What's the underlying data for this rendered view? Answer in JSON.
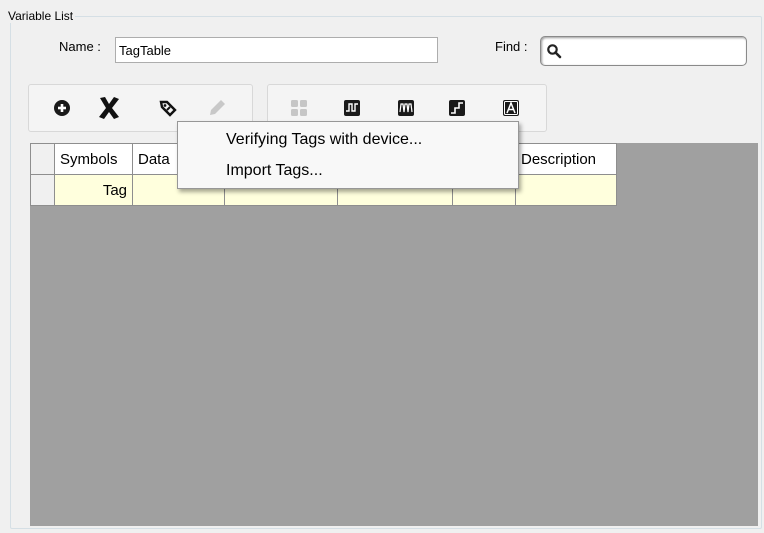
{
  "group": {
    "title": "Variable List"
  },
  "name_field": {
    "label": "Name :",
    "value": "TagTable"
  },
  "find_field": {
    "label": "Find :",
    "value": ""
  },
  "toolbar_left": [
    {
      "icon": "add-circle-icon"
    },
    {
      "icon": "delete-x-icon"
    },
    {
      "icon": "tag-icon"
    },
    {
      "icon": "edit-pencil-icon"
    }
  ],
  "toolbar_right": [
    {
      "icon": "grid-icon"
    },
    {
      "icon": "pulse-wave-icon"
    },
    {
      "icon": "multi-wave-icon"
    },
    {
      "icon": "step-icon"
    },
    {
      "icon": "text-a-icon"
    }
  ],
  "table": {
    "columns": [
      "Symbols",
      "Data",
      "",
      "",
      "",
      "Description"
    ],
    "rows": [
      [
        "Tag",
        "",
        "",
        "",
        "",
        ""
      ]
    ]
  },
  "context_menu": {
    "items": [
      "Verifying Tags with device...",
      "Import Tags..."
    ]
  },
  "colors": {
    "row_background": "#ffffdd",
    "grid_background": "#a0a0a0",
    "panel_background": "#f0f0f0"
  }
}
